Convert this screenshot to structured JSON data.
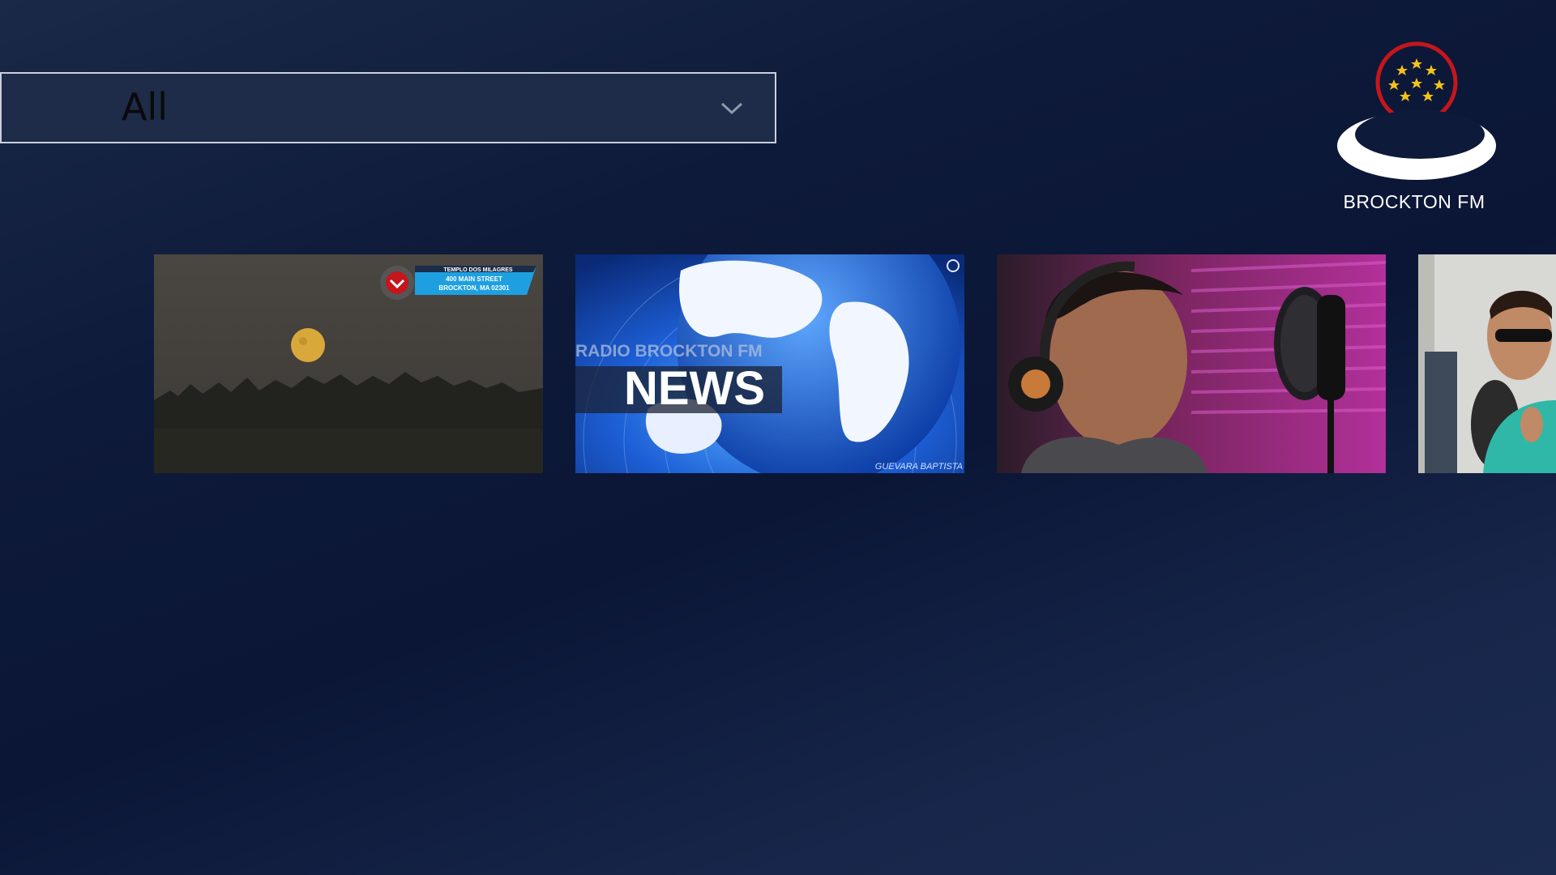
{
  "filter": {
    "selected": "All"
  },
  "brand": {
    "name": "BROCKTON FM"
  },
  "thumbnails": [
    {
      "banner_lines": [
        "TEMPLO DOS MILAGRES",
        "400 MAIN STREET",
        "BROCKTON, MA 02301"
      ]
    },
    {
      "overlay": "RADIO BROCKTON FM",
      "title": "NEWS",
      "credit": "GUEVARA BAPTISTA"
    },
    {
      "subject": "radio-host-headphones"
    },
    {
      "subject": "singer-sunglasses"
    }
  ],
  "colors": {
    "accent_red": "#c4161c",
    "globe_blue": "#1d5fd6"
  }
}
